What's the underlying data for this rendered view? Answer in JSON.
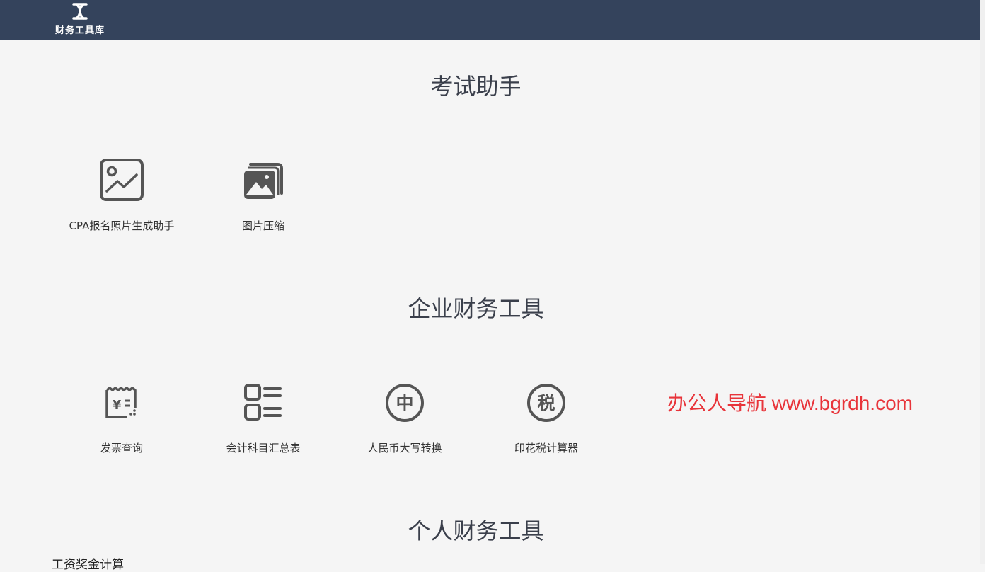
{
  "header": {
    "logo_text": "财务工具库",
    "logo_icon": "tool-library-logo-icon",
    "background": "#34435c"
  },
  "sections": [
    {
      "title": "考试助手",
      "tools": [
        {
          "label": "CPA报名照片生成助手",
          "icon": "photo-chart-icon"
        },
        {
          "label": "图片压缩",
          "icon": "image-stack-icon"
        }
      ]
    },
    {
      "title": "企业财务工具",
      "tools": [
        {
          "label": "发票查询",
          "icon": "invoice-receipt-icon"
        },
        {
          "label": "会计科目汇总表",
          "icon": "list-summary-icon"
        },
        {
          "label": "人民币大写转换",
          "icon": "zhong-character-icon"
        },
        {
          "label": "印花税计算器",
          "icon": "tax-character-icon"
        }
      ]
    },
    {
      "title": "个人财务工具",
      "tools": [
        {
          "label": "工资奖金计算"
        }
      ]
    }
  ],
  "watermark": {
    "text": "办公人导航 www.bgrdh.com",
    "color": "#e8343a"
  }
}
